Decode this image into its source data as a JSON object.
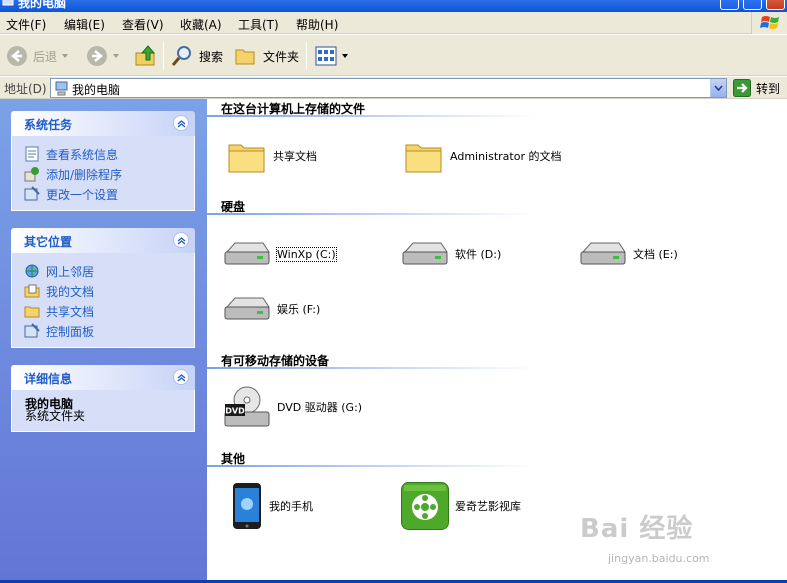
{
  "window": {
    "title": "我的电脑"
  },
  "menu": [
    "文件(F)",
    "编辑(E)",
    "查看(V)",
    "收藏(A)",
    "工具(T)",
    "帮助(H)"
  ],
  "toolbar": {
    "back": "后退",
    "search": "搜索",
    "folders": "文件夹"
  },
  "address": {
    "label": "地址(D)",
    "value": "我的电脑",
    "go": "转到"
  },
  "panels": {
    "system_tasks": {
      "title": "系统任务",
      "items": [
        "查看系统信息",
        "添加/删除程序",
        "更改一个设置"
      ]
    },
    "other_places": {
      "title": "其它位置",
      "items": [
        "网上邻居",
        "我的文档",
        "共享文档",
        "控制面板"
      ]
    },
    "details": {
      "title": "详细信息",
      "name": "我的电脑",
      "desc": "系统文件夹"
    }
  },
  "groups": {
    "files": {
      "title": "在这台计算机上存储的文件",
      "items": [
        "共享文档",
        "Administrator 的文档"
      ]
    },
    "drives": {
      "title": "硬盘",
      "items": [
        "WinXp (C:)",
        "软件 (D:)",
        "文档 (E:)",
        "娱乐 (F:)"
      ]
    },
    "removable": {
      "title": "有可移动存储的设备",
      "items": [
        "DVD 驱动器 (G:)"
      ],
      "dvd_badge": "DVD"
    },
    "other": {
      "title": "其他",
      "items": [
        "我的手机",
        "爱奇艺影视库"
      ]
    }
  },
  "watermark": {
    "brand": "Bai 经验",
    "site": "jingyan.baidu.com"
  },
  "colors": {
    "title_bar": "#0a55d6",
    "task_pane": "#6375d6",
    "link": "#215dc6",
    "chrome": "#ece9d8"
  }
}
